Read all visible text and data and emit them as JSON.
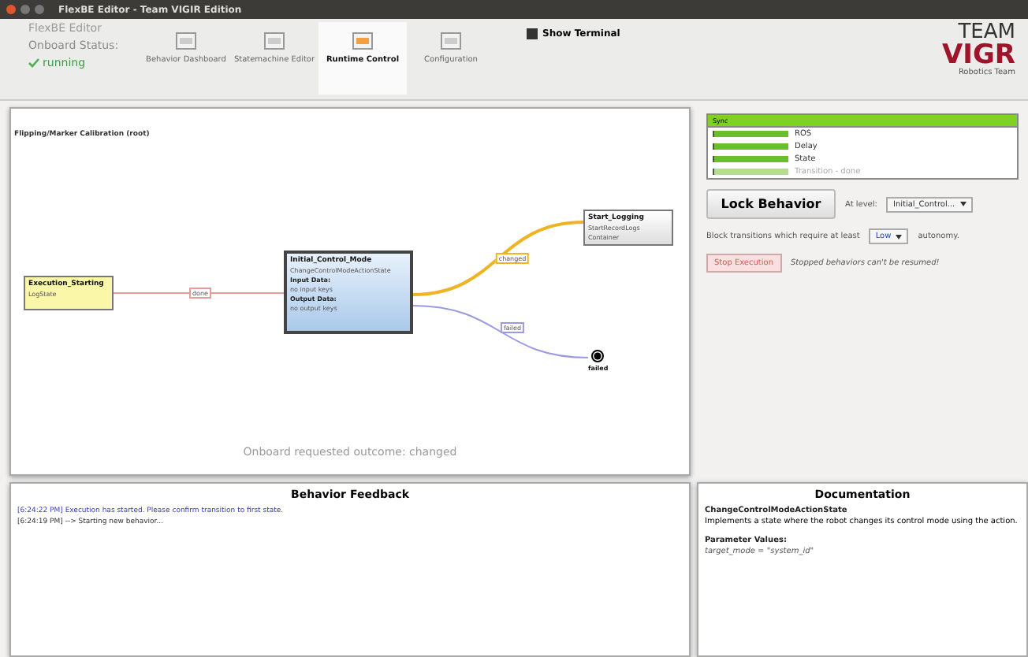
{
  "window": {
    "title": "FlexBE Editor - Team VIGIR Edition"
  },
  "status": {
    "app": "FlexBE Editor",
    "label": "Onboard Status:",
    "value": "running"
  },
  "toolbar": [
    {
      "label": "Behavior Dashboard",
      "selected": false
    },
    {
      "label": "Statemachine Editor",
      "selected": false
    },
    {
      "label": "Runtime Control",
      "selected": true
    },
    {
      "label": "Configuration",
      "selected": false
    }
  ],
  "show_terminal": {
    "label": "Show Terminal",
    "checked": true
  },
  "logo": {
    "top": "TEAM",
    "bottom": "VIGR",
    "tagline": "Robotics Team"
  },
  "canvas": {
    "title": "Flipping/Marker Calibration (root)",
    "outcome": "Onboard requested outcome: changed",
    "nodes": [
      {
        "kind": "plain",
        "name": "Execution_Starting",
        "type": "LogState",
        "active": false
      },
      {
        "kind": "detailed",
        "name": "Initial_Control_Mode",
        "type": "ChangeControlModeActionState",
        "input_title": "Input Data:",
        "input": "no input keys",
        "output_title": "Output Data:",
        "output": "no output keys",
        "active": true
      },
      {
        "kind": "plain",
        "name": "Start_Logging",
        "type": "StartRecordLogs",
        "type2": "Container",
        "active": false
      },
      {
        "kind": "outcome",
        "name": "failed"
      }
    ],
    "edges": [
      {
        "label": "done",
        "color": "#e89a9a"
      },
      {
        "label": "changed",
        "color": "#f0b323"
      },
      {
        "label": "failed",
        "color": "#9a9ae0"
      }
    ]
  },
  "sync": {
    "title": "Sync",
    "items": [
      {
        "label": "ROS",
        "level": 1,
        "active": true
      },
      {
        "label": "Delay",
        "level": 1,
        "active": true
      },
      {
        "label": "State",
        "level": 1,
        "active": true
      },
      {
        "label": "Transition - done",
        "level": 1,
        "active": false
      }
    ]
  },
  "lock": {
    "button": "Lock Behavior",
    "at_level": "At level:",
    "level_value": "Initial_Control..."
  },
  "autonomy": {
    "before": "Block transitions which require at least",
    "value": "Low",
    "after": "autonomy."
  },
  "stop": {
    "button": "Stop Execution",
    "note": "Stopped behaviors can't be resumed!"
  },
  "feedback": {
    "title": "Behavior Feedback",
    "lines": [
      {
        "text": "[6:24:22 PM] Execution has started. Please confirm transition to first state.",
        "kind": "hint"
      },
      {
        "text": "[6:24:19 PM] --> Starting new behavior...",
        "kind": "log"
      }
    ]
  },
  "documentation": {
    "title": "Documentation",
    "class": "ChangeControlModeActionState",
    "description": "Implements a state where the robot changes its control mode using the action.",
    "params_title": "Parameter Values:",
    "params": "target_mode = \"system_id\""
  }
}
